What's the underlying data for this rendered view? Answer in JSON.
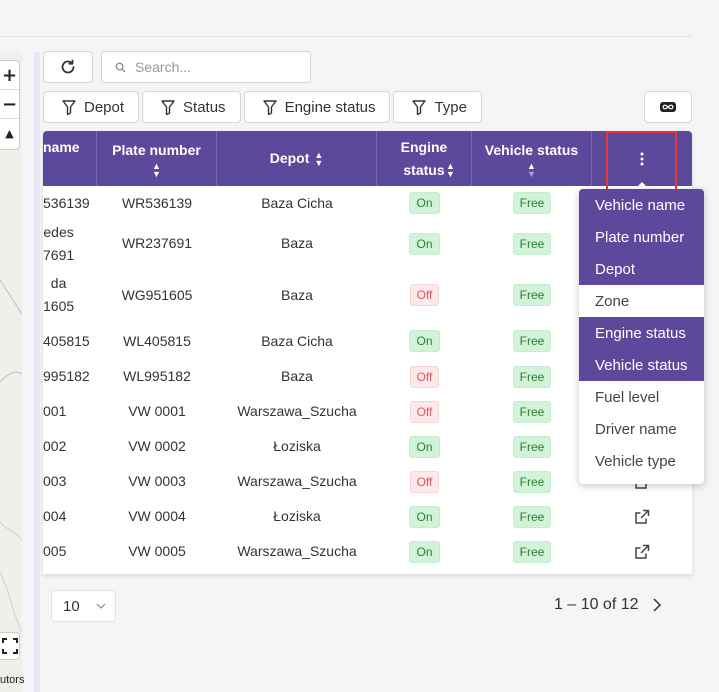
{
  "map": {
    "zoom_in": "+",
    "zoom_out": "−",
    "reset_north": "▲",
    "contributors": "utors",
    "fullscreen_icon": "fullscreen-icon"
  },
  "toolbar": {
    "refresh_icon": "refresh-icon",
    "search_placeholder": "Search...",
    "filters": [
      "Depot",
      "Status",
      "Engine status",
      "Type"
    ],
    "link_icon": "link-icon"
  },
  "table": {
    "columns": [
      "name",
      "Plate number",
      "Depot",
      "Engine status",
      "Vehicle status"
    ],
    "rows": [
      {
        "name": "536139",
        "plate": "WR536139",
        "depot": "Baza Cicha",
        "engine": "On",
        "status": "Free"
      },
      {
        "name": "edes\n7691",
        "plate": "WR237691",
        "depot": "Baza",
        "engine": "On",
        "status": "Free"
      },
      {
        "name": "da\n1605",
        "plate": "WG951605",
        "depot": "Baza",
        "engine": "Off",
        "status": "Free"
      },
      {
        "name": "405815",
        "plate": "WL405815",
        "depot": "Baza Cicha",
        "engine": "On",
        "status": "Free"
      },
      {
        "name": "995182",
        "plate": "WL995182",
        "depot": "Baza",
        "engine": "Off",
        "status": "Free"
      },
      {
        "name": "001",
        "plate": "VW 0001",
        "depot": "Warszawa_Szucha",
        "engine": "Off",
        "status": "Free"
      },
      {
        "name": "002",
        "plate": "VW 0002",
        "depot": "Łoziska",
        "engine": "On",
        "status": "Free"
      },
      {
        "name": "003",
        "plate": "VW 0003",
        "depot": "Warszawa_Szucha",
        "engine": "Off",
        "status": "Free"
      },
      {
        "name": "004",
        "plate": "VW 0004",
        "depot": "Łoziska",
        "engine": "On",
        "status": "Free"
      },
      {
        "name": "005",
        "plate": "VW 0005",
        "depot": "Warszawa_Szucha",
        "engine": "On",
        "status": "Free"
      }
    ]
  },
  "column_menu": {
    "icon": "more-vertical-icon",
    "items": [
      {
        "label": "Vehicle name",
        "selected": true
      },
      {
        "label": "Plate number",
        "selected": true
      },
      {
        "label": "Depot",
        "selected": true
      },
      {
        "label": "Zone",
        "selected": false
      },
      {
        "label": "Engine status",
        "selected": true
      },
      {
        "label": "Vehicle status",
        "selected": true
      },
      {
        "label": "Fuel level",
        "selected": false
      },
      {
        "label": "Driver name",
        "selected": false
      },
      {
        "label": "Vehicle type",
        "selected": false
      }
    ]
  },
  "pagination": {
    "page_size": "10",
    "range": "1 – 10 of 12"
  },
  "colors": {
    "header": "#5b4a9b",
    "on": "#2e7d32",
    "off": "#e0565f",
    "highlight": "#e53935"
  }
}
